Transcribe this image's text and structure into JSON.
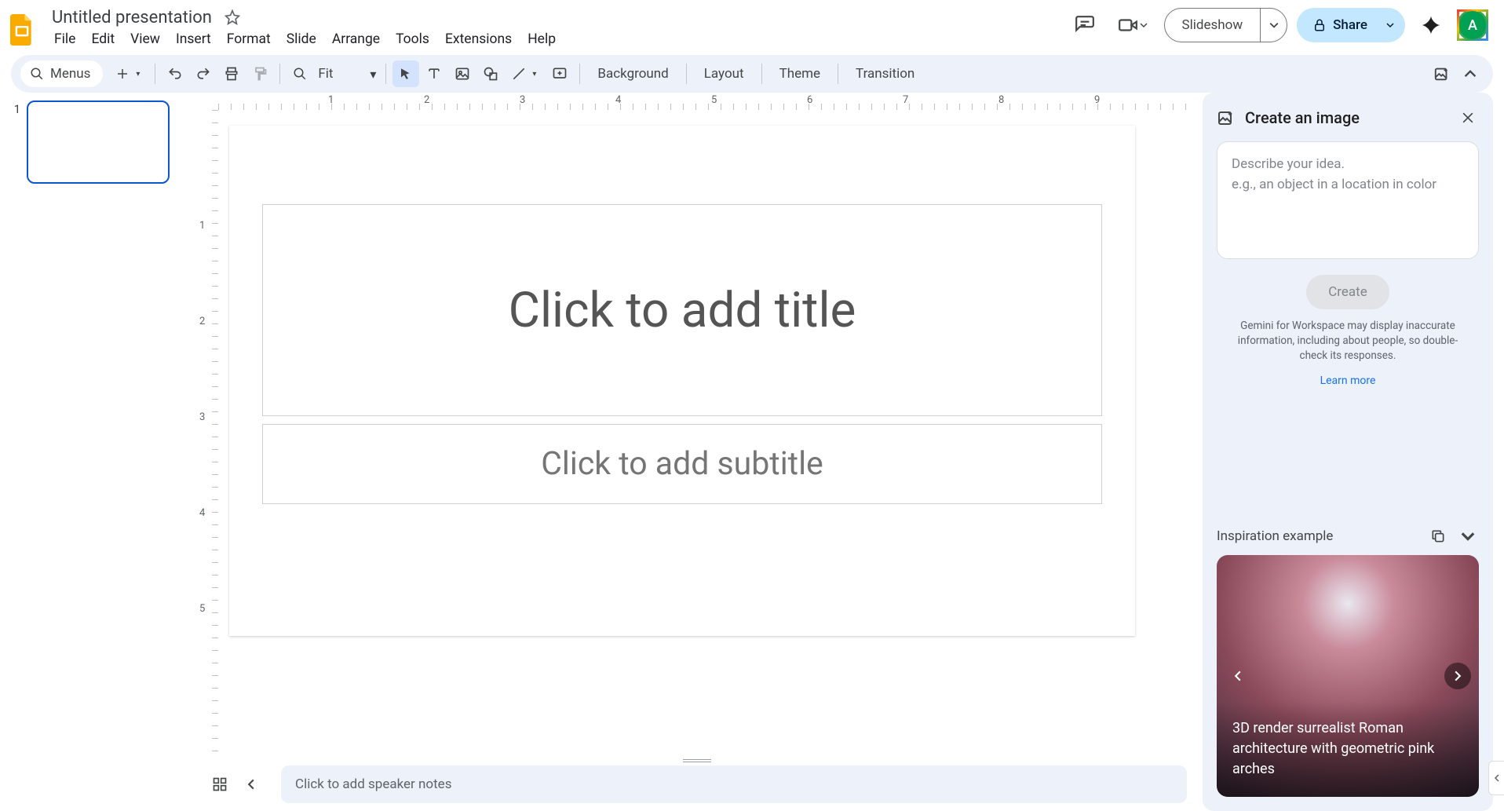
{
  "header": {
    "doc_title": "Untitled presentation",
    "slideshow": "Slideshow",
    "share": "Share",
    "avatar_letter": "A"
  },
  "menubar": [
    "File",
    "Edit",
    "View",
    "Insert",
    "Format",
    "Slide",
    "Arrange",
    "Tools",
    "Extensions",
    "Help"
  ],
  "toolbar": {
    "menus_label": "Menus",
    "zoom_label": "Fit",
    "background": "Background",
    "layout": "Layout",
    "theme": "Theme",
    "transition": "Transition"
  },
  "filmstrip": {
    "slides": [
      {
        "num": "1"
      }
    ]
  },
  "canvas": {
    "title_placeholder": "Click to add title",
    "subtitle_placeholder": "Click to add subtitle"
  },
  "ruler_h_labels": [
    "1",
    "2",
    "3",
    "4",
    "5",
    "6",
    "7",
    "8",
    "9"
  ],
  "ruler_v_labels": [
    "1",
    "2",
    "3",
    "4",
    "5"
  ],
  "notes_placeholder": "Click to add speaker notes",
  "sidebar": {
    "title": "Create an image",
    "prompt_line1": "Describe your idea.",
    "prompt_line2": "e.g., an object in a location in color",
    "create": "Create",
    "disclaimer": "Gemini for Workspace may display inaccurate information, including about people, so double-check its responses.",
    "learn_more": "Learn more",
    "inspiration_title": "Inspiration example",
    "inspiration_caption": "3D render surrealist Roman architecture with geometric pink arches"
  }
}
